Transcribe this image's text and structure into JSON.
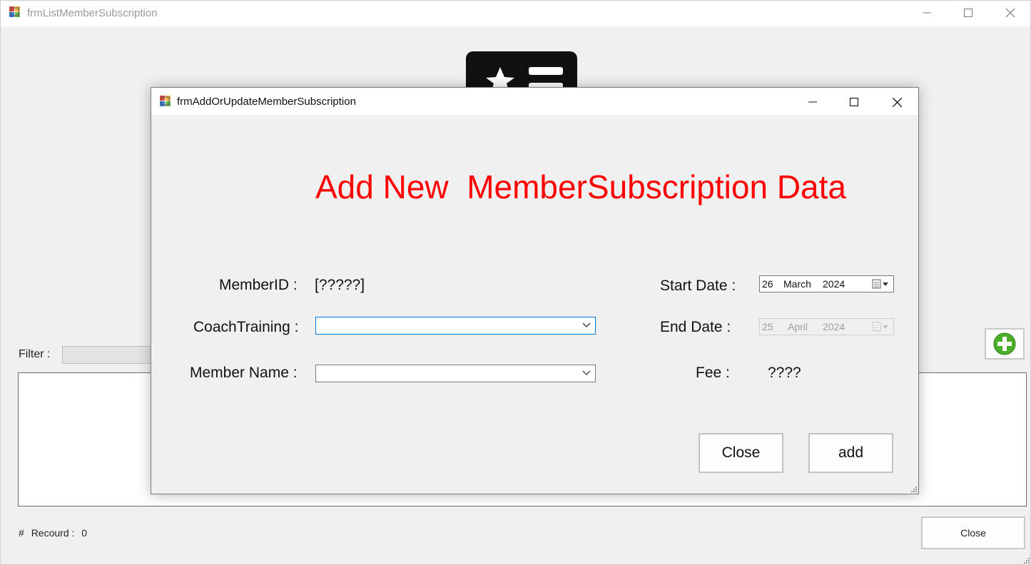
{
  "parent_window": {
    "title": "frmListMemberSubscription",
    "filter_label": "Filter :",
    "records_hash": "#",
    "records_label": "Recourd :",
    "records_count": "0",
    "close_label": "Close"
  },
  "dialog": {
    "title": "frmAddOrUpdateMemberSubscription",
    "heading": "Add New  MemberSubscription Data",
    "member_id_label": "MemberID :",
    "member_id_value": "[?????]",
    "coach_training_label": "CoachTraining :",
    "coach_training_value": "",
    "member_name_label": "Member Name :",
    "member_name_value": "",
    "start_date_label": "Start Date :",
    "start_date": {
      "day": "26",
      "month": "March",
      "year": "2024"
    },
    "end_date_label": "End Date :",
    "end_date": {
      "day": "25",
      "month": "April",
      "year": "2024"
    },
    "fee_label": "Fee :",
    "fee_value": "????",
    "close_button": "Close",
    "add_button": "add"
  },
  "colors": {
    "heading": "#ff0000",
    "focus_border": "#0078d7",
    "add_icon": "#4caf28"
  },
  "icons": [
    "app-icon",
    "minimize-icon",
    "maximize-icon",
    "close-icon",
    "chevron-down-icon",
    "calendar-icon",
    "add-circle-icon",
    "member-card-icon",
    "resize-grip-icon"
  ]
}
